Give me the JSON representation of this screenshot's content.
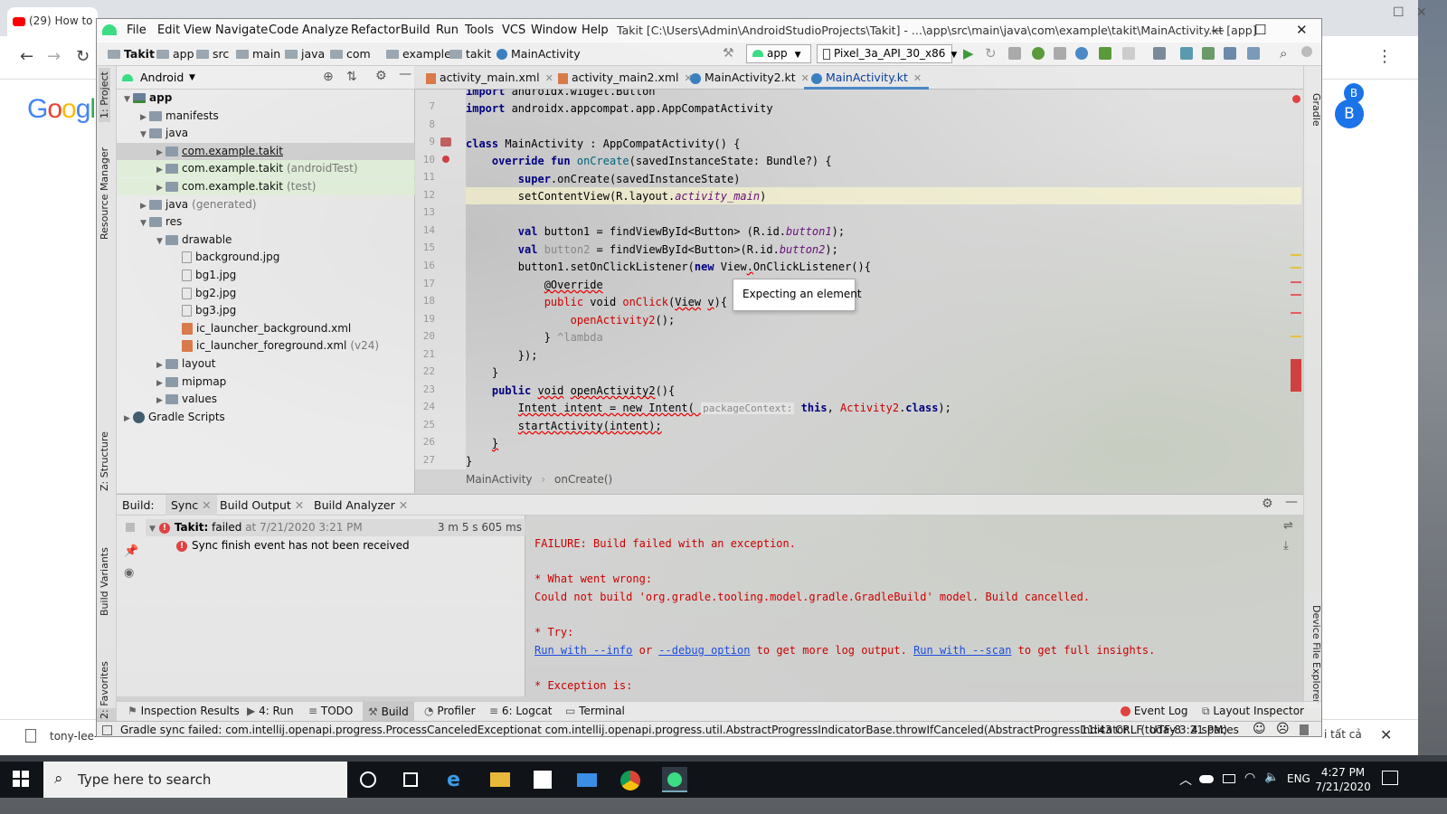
{
  "browser": {
    "tab_title": "(29) How to",
    "avatar": "B",
    "google": "Goog",
    "download_file": "tony-lee-",
    "show_all": "i tất cả"
  },
  "ide": {
    "menu": [
      "File",
      "Edit",
      "View",
      "Navigate",
      "Code",
      "Analyze",
      "Refactor",
      "Build",
      "Run",
      "Tools",
      "VCS",
      "Window",
      "Help"
    ],
    "title": "Takit [C:\\Users\\Admin\\AndroidStudioProjects\\Takit] - ...\\app\\src\\main\\java\\com\\example\\takit\\MainActivity.kt [app]",
    "breadcrumbs": [
      "Takit",
      "app",
      "src",
      "main",
      "java",
      "com",
      "example",
      "takit",
      "MainActivity"
    ],
    "run_config": "app",
    "device": "Pixel_3a_API_30_x86",
    "left_stripe": [
      "1: Project",
      "Resource Manager",
      "Z: Structure",
      "Build Variants",
      "2: Favorites"
    ],
    "right_stripe": [
      "Gradle",
      "Device File Explorer"
    ],
    "project": {
      "view": "Android",
      "tree": [
        {
          "label": "app",
          "indent": 0,
          "icon": "mod",
          "bold": true,
          "open": true
        },
        {
          "label": "manifests",
          "indent": 1,
          "icon": "fold"
        },
        {
          "label": "java",
          "indent": 1,
          "icon": "fold",
          "open": true
        },
        {
          "label": "com.example.takit",
          "indent": 2,
          "icon": "pkg",
          "selected": true
        },
        {
          "label": "com.example.takit",
          "sec": "(androidTest)",
          "indent": 2,
          "icon": "pkg",
          "green": true
        },
        {
          "label": "com.example.takit",
          "sec": "(test)",
          "indent": 2,
          "icon": "pkg",
          "green": true
        },
        {
          "label": "java",
          "sec": "(generated)",
          "indent": 1,
          "icon": "fold"
        },
        {
          "label": "res",
          "indent": 1,
          "icon": "fold",
          "open": true
        },
        {
          "label": "drawable",
          "indent": 2,
          "icon": "fold",
          "open": true
        },
        {
          "label": "background.jpg",
          "indent": 3,
          "icon": "img",
          "leaf": true
        },
        {
          "label": "bg1.jpg",
          "indent": 3,
          "icon": "img",
          "leaf": true
        },
        {
          "label": "bg2.jpg",
          "indent": 3,
          "icon": "img",
          "leaf": true
        },
        {
          "label": "bg3.jpg",
          "indent": 3,
          "icon": "img",
          "leaf": true
        },
        {
          "label": "ic_launcher_background.xml",
          "indent": 3,
          "icon": "xml",
          "leaf": true
        },
        {
          "label": "ic_launcher_foreground.xml",
          "sec": "(v24)",
          "indent": 3,
          "icon": "xml",
          "leaf": true
        },
        {
          "label": "layout",
          "indent": 2,
          "icon": "fold"
        },
        {
          "label": "mipmap",
          "indent": 2,
          "icon": "fold"
        },
        {
          "label": "values",
          "indent": 2,
          "icon": "fold"
        },
        {
          "label": "Gradle Scripts",
          "indent": 0,
          "icon": "gr"
        }
      ]
    },
    "tabs": [
      {
        "label": "activity_main.xml",
        "kind": "xml"
      },
      {
        "label": "activity_main2.xml",
        "kind": "xml"
      },
      {
        "label": "MainActivity2.kt",
        "kind": "kt"
      },
      {
        "label": "MainActivity.kt",
        "kind": "kt",
        "active": true
      }
    ],
    "line_numbers": [
      "7",
      "8",
      "9",
      "10",
      "11",
      "12",
      "13",
      "14",
      "15",
      "16",
      "17",
      "18",
      "19",
      "20",
      "21",
      "22",
      "23",
      "24",
      "25",
      "26",
      "27"
    ],
    "tooltip": "Expecting an element",
    "editor_breadcrumb": [
      "MainActivity",
      "onCreate()"
    ],
    "build": {
      "tabs": [
        "Build:",
        "Sync",
        "Build Output",
        "Build Analyzer"
      ],
      "task_name": "Takit:",
      "task_status": "failed",
      "task_time": "at 7/21/2020 3:21 PM",
      "task_duration": "3 m 5 s 605 ms",
      "event": "Sync finish event has not been received",
      "out1": "FAILURE: Build failed with an exception.",
      "out2": "* What went wrong:",
      "out3": "Could not build 'org.gradle.tooling.model.gradle.GradleBuild' model. Build cancelled.",
      "out4": "* Try:",
      "try_l1": "Run with --info",
      "try_or": " or ",
      "try_l2": "--debug option",
      "try_mid": " to get more log output. ",
      "try_l3": "Run with --scan",
      "try_end": " to get full insights.",
      "out6": "* Exception is:"
    },
    "bottom_tools": [
      "Inspection Results",
      "4: Run",
      "TODO",
      "Build",
      "Profiler",
      "6: Logcat",
      "Terminal"
    ],
    "bottom_right_tools": [
      "Event Log",
      "Layout Inspector"
    ],
    "status": {
      "message": "Gradle sync failed: com.intellij.openapi.progress.ProcessCanceledExceptionat com.intellij.openapi.progress.util.AbstractProgressIndicatorBase.throwIfCanceled(AbstractProgressIndicator... (today 3:21 PM)",
      "pos": "11:43",
      "eol": "CRLF",
      "enc": "UTF-8",
      "indent": "4 spaces"
    }
  },
  "taskbar": {
    "search": "Type here to search",
    "lang": "ENG",
    "time": "4:27 PM",
    "date": "7/21/2020"
  }
}
